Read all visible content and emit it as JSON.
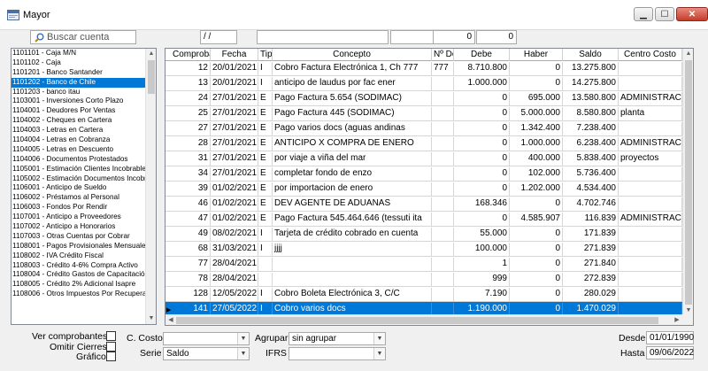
{
  "window": {
    "title": "Mayor",
    "minimize": "▁",
    "maximize": "☐",
    "close": "✕"
  },
  "filters": {
    "date_value": "/ /",
    "num1": "0",
    "num2": "0"
  },
  "search": {
    "placeholder": "Buscar cuenta"
  },
  "accounts": [
    "1101101 - Caja M/N",
    "1101102 - Caja",
    "1101201 - Banco Santander",
    "1101202 - Banco de Chile",
    "1101203 - banco itau",
    "1103001 - Inversiones Corto Plazo",
    "1104001 - Deudores Por Ventas",
    "1104002 - Cheques en Cartera",
    "1104003 - Letras en Cartera",
    "1104004 - Letras en Cobranza",
    "1104005 - Letras en Descuento",
    "1104006 - Documentos Protestados",
    "1105001 - Estimación Clientes Incobrables",
    "1105002 - Estimación Documentos Incobrables",
    "1106001 - Anticipo de Sueldo",
    "1106002 - Préstamos al Personal",
    "1106003 - Fondos Por Rendir",
    "1107001 - Anticipo a Proveedores",
    "1107002 - Anticipo a Honorarios",
    "1107003 - Otras Cuentas por Cobrar",
    "1108001 - Pagos Provisionales Mensuales",
    "1108002 - IVA Crédito Fiscal",
    "1108003 - Crédito 4-6% Compra Activo",
    "1108004 - Crédito Gastos de Capacitación",
    "1108005 - Crédito 2% Adicional Isapre",
    "1108006 - Otros Impuestos Por Recuperar"
  ],
  "selected_account_index": 3,
  "grid": {
    "columns": [
      "Comprobante",
      "Fecha",
      "Tipo",
      "Concepto",
      "Nº Doc",
      "Debe",
      "Haber",
      "Saldo",
      "Centro Costo"
    ],
    "rows": [
      [
        "12",
        "20/01/2021",
        "I",
        "Cobro Factura Electrónica 1, Ch 777",
        "777",
        "8.710.800",
        "0",
        "13.275.800",
        ""
      ],
      [
        "13",
        "20/01/2021",
        "I",
        "anticipo de laudus por fac ener",
        "",
        "1.000.000",
        "0",
        "14.275.800",
        ""
      ],
      [
        "24",
        "27/01/2021",
        "E",
        "Pago Factura 5.654 (SODIMAC)",
        "",
        "0",
        "695.000",
        "13.580.800",
        "ADMINISTRACION"
      ],
      [
        "25",
        "27/01/2021",
        "E",
        "Pago Factura 445 (SODIMAC)",
        "",
        "0",
        "5.000.000",
        "8.580.800",
        "planta"
      ],
      [
        "27",
        "27/01/2021",
        "E",
        "Pago varios docs (aguas andinas",
        "",
        "0",
        "1.342.400",
        "7.238.400",
        ""
      ],
      [
        "28",
        "27/01/2021",
        "E",
        "ANTICIPO X COMPRA DE ENERO",
        "",
        "0",
        "1.000.000",
        "6.238.400",
        "ADMINISTRACION"
      ],
      [
        "31",
        "27/01/2021",
        "E",
        "por viaje a viña del mar",
        "",
        "0",
        "400.000",
        "5.838.400",
        "proyectos"
      ],
      [
        "34",
        "27/01/2021",
        "E",
        "completar fondo de enzo",
        "",
        "0",
        "102.000",
        "5.736.400",
        ""
      ],
      [
        "39",
        "01/02/2021",
        "E",
        "por importacion de enero",
        "",
        "0",
        "1.202.000",
        "4.534.400",
        ""
      ],
      [
        "46",
        "01/02/2021",
        "E",
        "DEV AGENTE DE ADUANAS",
        "",
        "168.346",
        "0",
        "4.702.746",
        ""
      ],
      [
        "47",
        "01/02/2021",
        "E",
        "Pago Factura 545.464.646 (tessuti ita",
        "",
        "0",
        "4.585.907",
        "116.839",
        "ADMINISTRACION"
      ],
      [
        "49",
        "08/02/2021",
        "I",
        "Tarjeta de crédito  cobrado en cuenta",
        "",
        "55.000",
        "0",
        "171.839",
        ""
      ],
      [
        "68",
        "31/03/2021",
        "I",
        "jjjj",
        "",
        "100.000",
        "0",
        "271.839",
        ""
      ],
      [
        "77",
        "28/04/2021",
        "",
        "",
        "",
        "1",
        "0",
        "271.840",
        ""
      ],
      [
        "78",
        "28/04/2021",
        "",
        "",
        "",
        "999",
        "0",
        "272.839",
        ""
      ],
      [
        "128",
        "12/05/2022",
        "I",
        "Cobro Boleta Electrónica 3, C/C",
        "",
        "7.190",
        "0",
        "280.029",
        ""
      ],
      [
        "141",
        "27/05/2022",
        "I",
        "Cobro varios docs",
        "",
        "1.190.000",
        "0",
        "1.470.029",
        ""
      ]
    ],
    "selected_row_index": 16
  },
  "bottom": {
    "ver_comprobantes": "Ver comprobantes",
    "omitir_cierres": "Omitir Cierres",
    "grafico": "Gráfico",
    "c_costo_label": "C. Costo",
    "c_costo_value": "",
    "serie_label": "Serie",
    "serie_value": "Saldo",
    "agrupar_label": "Agrupar",
    "agrupar_value": "sin agrupar",
    "ifrs_label": "IFRS",
    "ifrs_value": "",
    "desde_label": "Desde",
    "desde_value": "01/01/1990",
    "hasta_label": "Hasta",
    "hasta_value": "09/06/2022"
  }
}
